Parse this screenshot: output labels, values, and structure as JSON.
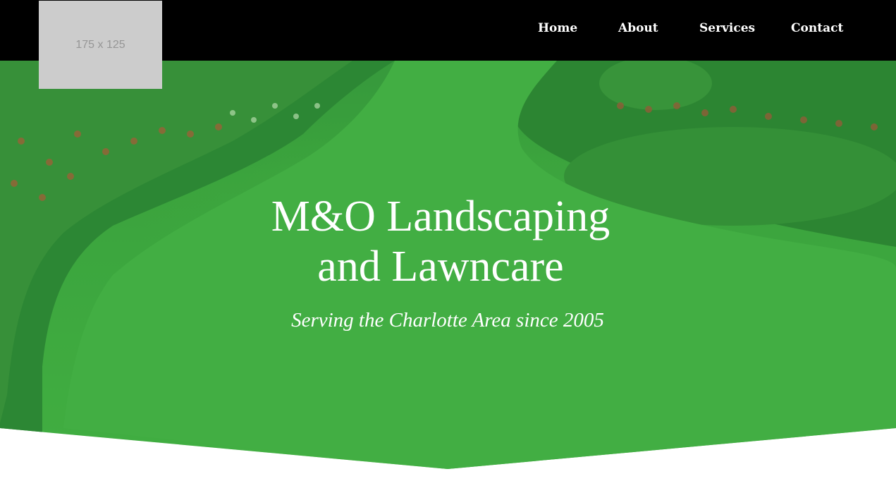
{
  "logo": {
    "placeholder_text": "175 x 125"
  },
  "nav": {
    "items": [
      {
        "label": "Home"
      },
      {
        "label": "About"
      },
      {
        "label": "Services"
      },
      {
        "label": "Contact"
      }
    ]
  },
  "hero": {
    "title_line1": "M&O Landscaping",
    "title_line2": "and Lawncare",
    "subtitle": "Serving the Charlotte Area since 2005"
  },
  "colors": {
    "header_bg": "#000000",
    "logo_bg": "#cccccc",
    "hero_green": "#4cb548",
    "text": "#ffffff"
  }
}
